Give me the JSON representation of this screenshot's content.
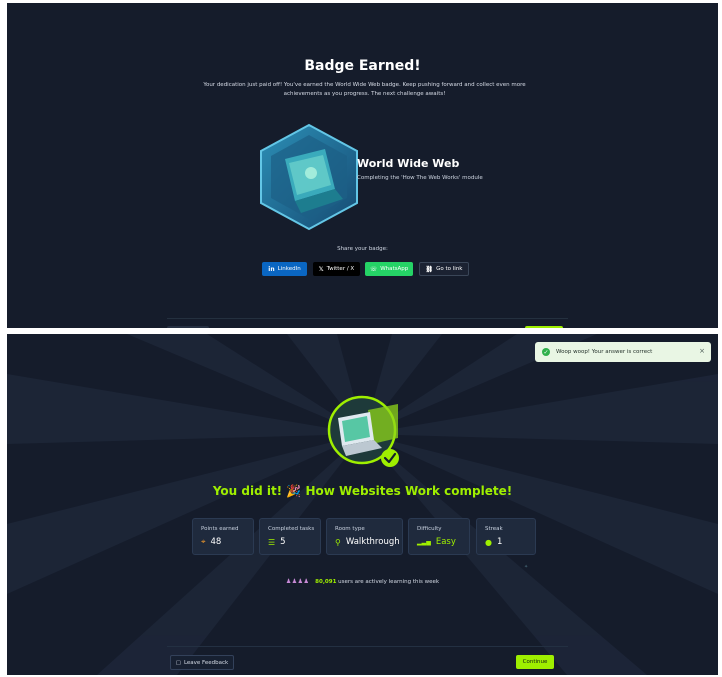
{
  "top": {
    "title": "Badge Earned!",
    "subtitle": "Your dedication just paid off! You've earned the World Wide Web badge. Keep pushing forward and collect even more achievements as you progress. The next challenge awaits!",
    "badge_name": "World Wide Web",
    "badge_desc": "Completing the 'How The Web Works' module",
    "share_label": "Share your badge:",
    "share_buttons": [
      {
        "label": "LinkedIn",
        "icon": "in",
        "color": "#0a66c2"
      },
      {
        "label": "Twitter / X",
        "icon": "𝕏",
        "color": "#000000"
      },
      {
        "label": "WhatsApp",
        "icon": "☏",
        "color": "#25d366"
      },
      {
        "label": "Go to link",
        "icon": "⛓",
        "color": "#1b2232"
      }
    ]
  },
  "bottom": {
    "toast_text": "Woop woop! Your answer is correct",
    "toast_close": "×",
    "done_title": "You did it! 🎉 How Websites Work complete!",
    "stats": [
      {
        "label": "Points earned",
        "value": "48",
        "icon": "⌖",
        "icon_color": "#f39a2b"
      },
      {
        "label": "Completed tasks",
        "value": "5",
        "icon": "☰",
        "icon_color": "#9fef00"
      },
      {
        "label": "Room type",
        "value": "Walkthrough",
        "icon": "⚲",
        "icon_color": "#9fef00"
      },
      {
        "label": "Difficulty",
        "value": "Easy",
        "icon": "▂▃▅",
        "icon_color": "#9fef00"
      },
      {
        "label": "Streak",
        "value": "1",
        "icon": "●",
        "icon_color": "#9fef00"
      }
    ],
    "active_users_count": "80,091",
    "active_users_text": "users are actively learning this week",
    "feedback_label": "Leave Feedback",
    "continue_label": "Continue",
    "accent_color": "#9fef00"
  }
}
